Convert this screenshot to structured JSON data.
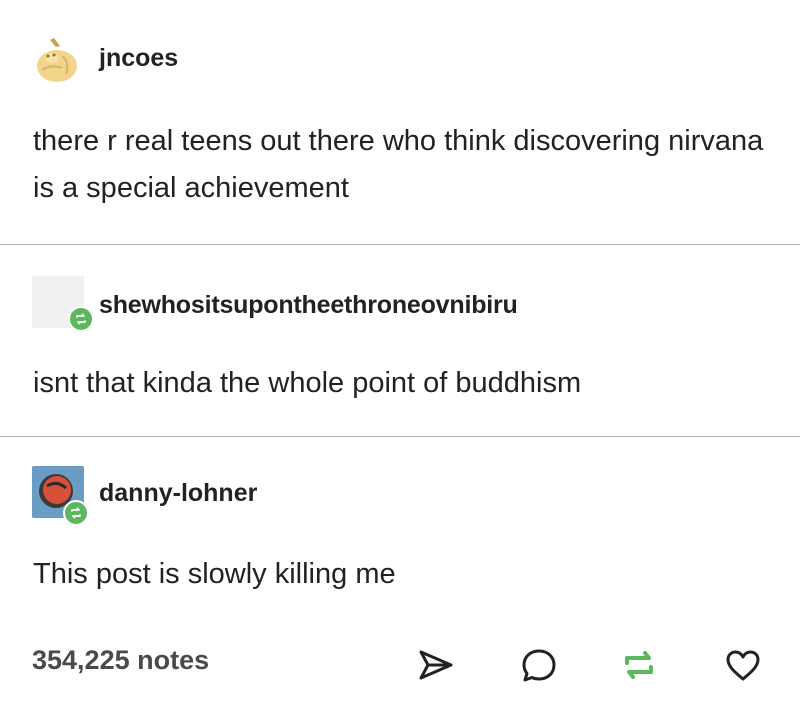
{
  "posts": [
    {
      "username": "jncoes",
      "text": "there r real teens out there who think discovering nirvana is a special achievement"
    },
    {
      "username": "shewhositsupontheethroneovnibiru",
      "text": "isnt that kinda the whole point of buddhism"
    },
    {
      "username": "danny-lohner",
      "text": "This post is slowly killing me"
    }
  ],
  "footer": {
    "notes": "354,225 notes"
  },
  "colors": {
    "reblog_green": "#5bb85c",
    "text": "#222222",
    "divider": "#b0b0b0"
  },
  "icons": [
    "share-icon",
    "reply-icon",
    "reblog-icon",
    "like-icon"
  ]
}
